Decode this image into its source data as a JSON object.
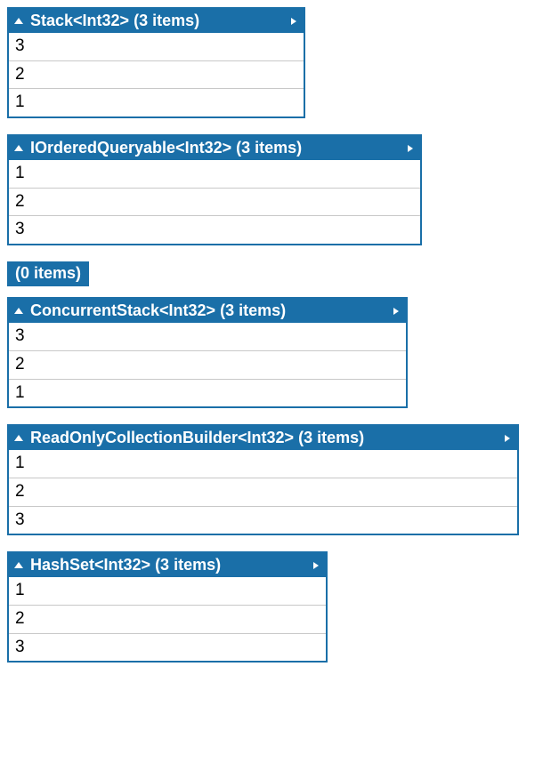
{
  "collections": [
    {
      "title": "Stack<Int32> (3 items)",
      "items": [
        "3",
        "2",
        "1"
      ]
    },
    {
      "title": "IOrderedQueryable<Int32> (3 items)",
      "items": [
        "1",
        "2",
        "3"
      ]
    },
    {
      "title": "(0 items)",
      "items": []
    },
    {
      "title": "ConcurrentStack<Int32> (3 items)",
      "items": [
        "3",
        "2",
        "1"
      ]
    },
    {
      "title": "ReadOnlyCollectionBuilder<Int32> (3 items)",
      "items": [
        "1",
        "2",
        "3"
      ]
    },
    {
      "title": "HashSet<Int32> (3 items)",
      "items": [
        "1",
        "2",
        "3"
      ]
    }
  ]
}
